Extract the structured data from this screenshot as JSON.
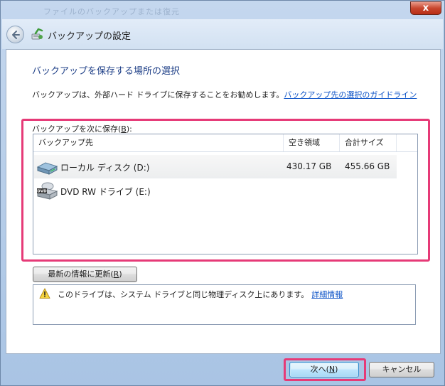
{
  "window": {
    "title_ghost": "ファイルのバックアップまたは復元",
    "close_label": "x"
  },
  "header": {
    "title": "バックアップの設定"
  },
  "main": {
    "heading": "バックアップを保存する場所の選択",
    "intro_text": "バックアップは、外部ハード ドライブに保存することをお勧めします。",
    "intro_link": "バックアップ先の選択のガイドライン"
  },
  "destinations": {
    "group_label_prefix": "バックアップを次に保存(",
    "group_label_key": "B",
    "group_label_suffix": "):",
    "columns": [
      "バックアップ先",
      "空き領域",
      "合計サイズ",
      ""
    ],
    "rows": [
      {
        "name": "ローカル ディスク (D:)",
        "free": "430.17 GB",
        "total": "455.66 GB",
        "icon": "hard-drive-icon"
      },
      {
        "name": "DVD RW ドライブ (E:)",
        "free": "",
        "total": "",
        "icon": "dvd-drive-icon"
      }
    ]
  },
  "refresh_button": {
    "prefix": "最新の情報に更新(",
    "key": "R",
    "suffix": ")"
  },
  "warning": {
    "icon": "warning-icon",
    "text": "このドライブは、システム ドライブと同じ物理ディスク上にあります。",
    "link": "詳細情報"
  },
  "footer": {
    "next_prefix": "次へ(",
    "next_key": "N",
    "next_suffix": ")",
    "cancel_label": "キャンセル"
  },
  "colors": {
    "highlight": "#e63a77",
    "heading": "#1e3f87",
    "link": "#0b52c7"
  }
}
